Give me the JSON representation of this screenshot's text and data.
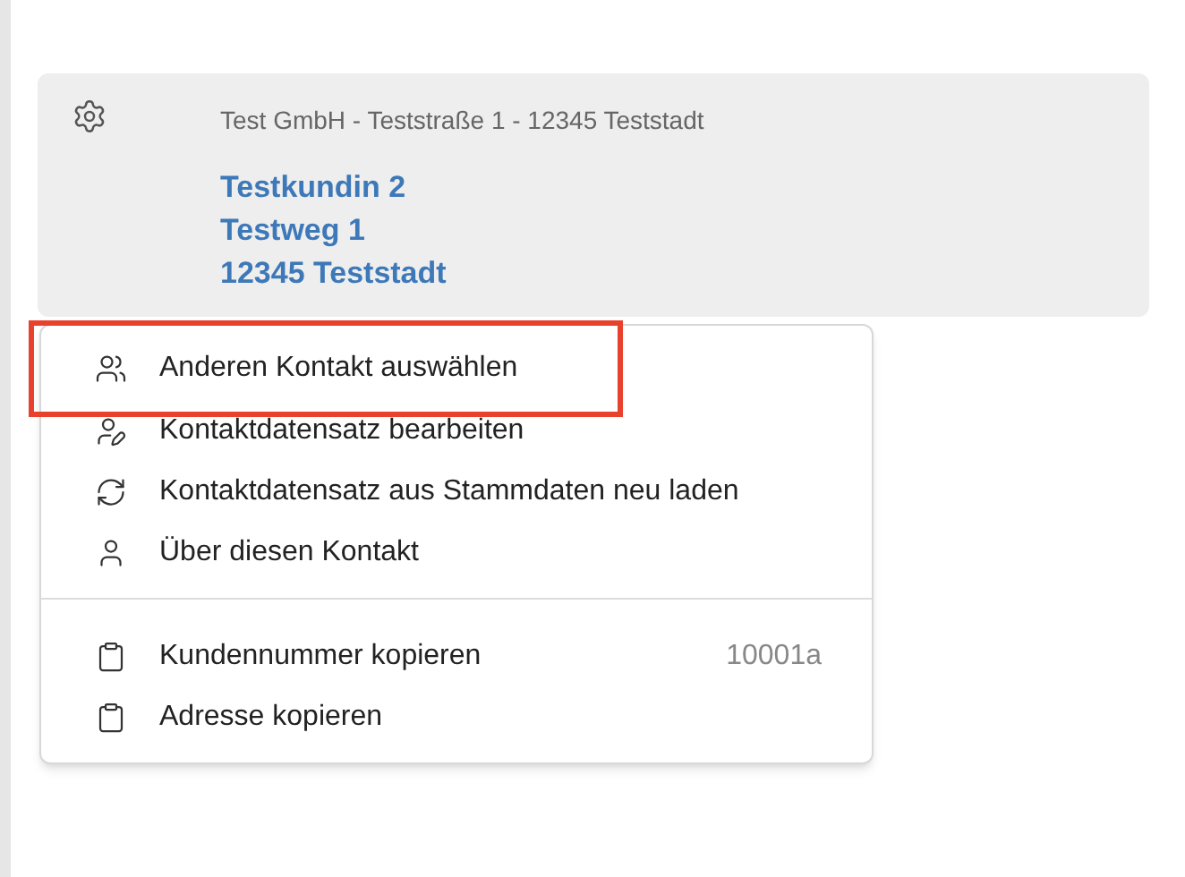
{
  "card": {
    "header": "Test GmbH - Teststraße 1 - 12345 Teststadt",
    "address_lines": [
      "Testkundin 2",
      "Testweg 1",
      "12345 Teststadt"
    ]
  },
  "menu": {
    "groups": [
      {
        "items": [
          {
            "kind": "users",
            "label": "Anderen Kontakt auswählen",
            "highlighted": true
          },
          {
            "kind": "user-edit",
            "label": "Kontaktdatensatz bearbeiten",
            "highlighted": false
          },
          {
            "kind": "refresh",
            "label": "Kontaktdatensatz aus Stammdaten neu laden",
            "highlighted": false
          },
          {
            "kind": "user",
            "label": "Über diesen Kontakt",
            "highlighted": false
          }
        ]
      },
      {
        "items": [
          {
            "kind": "clipboard",
            "label": "Kundennummer kopieren",
            "value": "10001a",
            "highlighted": false
          },
          {
            "kind": "clipboard",
            "label": "Adresse kopieren",
            "highlighted": false
          }
        ]
      }
    ]
  }
}
